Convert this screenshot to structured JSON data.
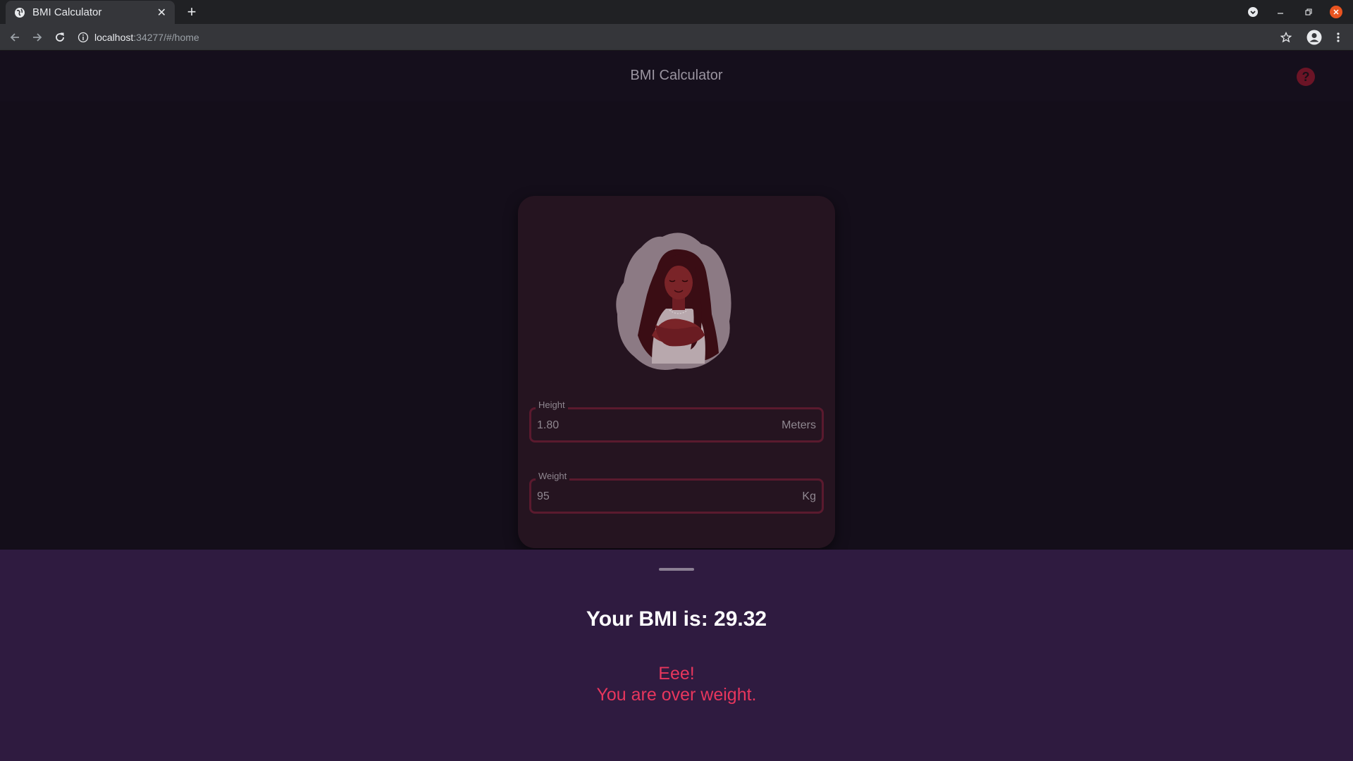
{
  "browser": {
    "tab_title": "BMI Calculator",
    "new_tab_label": "+",
    "url_host": "localhost",
    "url_path": ":34277/#/home"
  },
  "app": {
    "title": "BMI Calculator",
    "help_label": "?"
  },
  "form": {
    "height": {
      "label": "Height",
      "value": "1.80",
      "unit": "Meters"
    },
    "weight": {
      "label": "Weight",
      "value": "95",
      "unit": "Kg"
    }
  },
  "result": {
    "bmi_text": "Your BMI is: 29.32",
    "message_line1": "Eee!",
    "message_line2": "You are over weight."
  },
  "colors": {
    "background": "#140e1a",
    "card": "#251420",
    "sheet": "#2f1b40",
    "accent": "#e8365d",
    "field_border": "#5a1a2e"
  },
  "icons": [
    "globe-icon",
    "close-icon",
    "back-arrow-icon",
    "forward-arrow-icon",
    "reload-icon",
    "info-icon",
    "star-icon",
    "profile-icon",
    "more-vert-icon",
    "help-icon"
  ]
}
